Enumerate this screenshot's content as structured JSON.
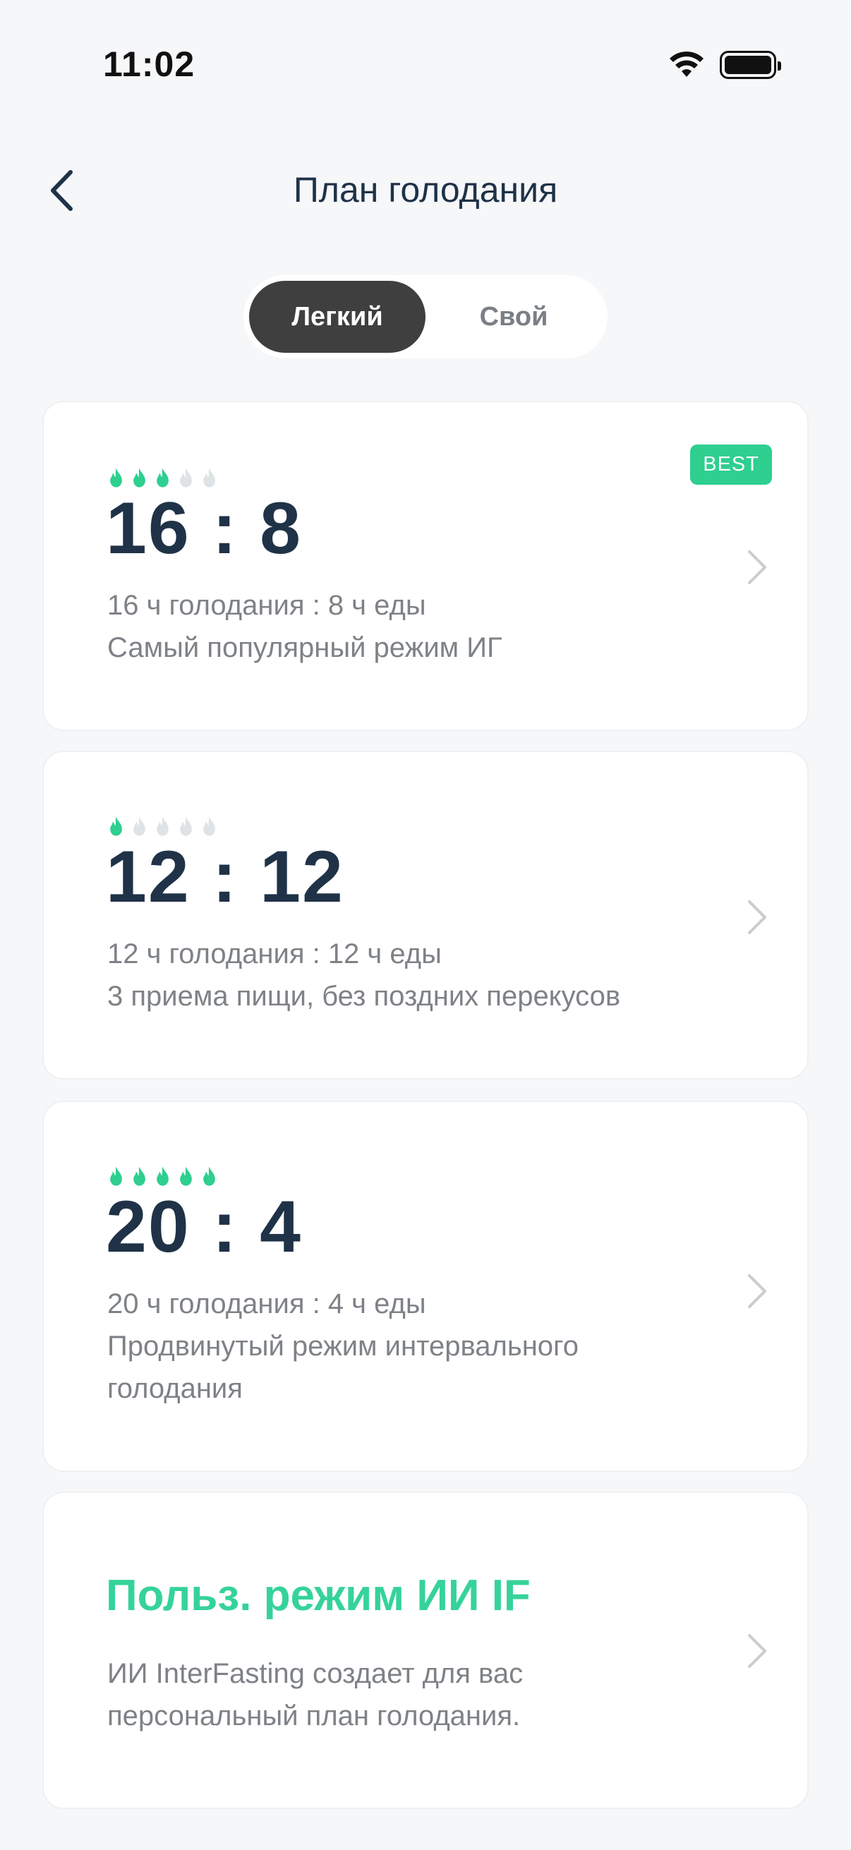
{
  "status_bar": {
    "time": "11:02"
  },
  "header": {
    "title": "План голодания"
  },
  "segments": {
    "easy": "Легкий",
    "custom": "Свой"
  },
  "plans": [
    {
      "ratio": "16 : 8",
      "line1": "16 ч голодания : 8 ч еды",
      "line2": "Самый популярный режим ИГ",
      "intensity": 3,
      "badge": "BEST"
    },
    {
      "ratio": "12 : 12",
      "line1": "12 ч голодания : 12 ч еды",
      "line2": "3 приема пищи, без поздних перекусов",
      "intensity": 1
    },
    {
      "ratio": "20 : 4",
      "line1": "20 ч голодания : 4 ч еды",
      "line2": "Продвинутый режим интервального голодания",
      "intensity": 5
    }
  ],
  "custom_plan": {
    "title": "Польз. режим ИИ IF",
    "description": "ИИ InterFasting создает для вас персональный план голодания."
  },
  "colors": {
    "accent_green": "#2ecf8f",
    "inactive_flame": "#dfe3e6",
    "title_dark": "#1f3247"
  }
}
